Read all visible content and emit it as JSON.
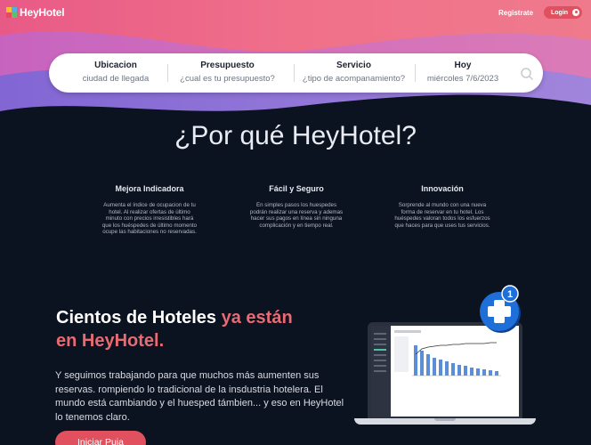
{
  "header": {
    "logo_text": "HeyHotel",
    "register_label": "Registrate",
    "login_label": "Login"
  },
  "search": {
    "location": {
      "title": "Ubicacion",
      "placeholder": "ciudad de llegada"
    },
    "budget": {
      "title": "Presupuesto",
      "placeholder": "¿cual es tu presupuesto?"
    },
    "service": {
      "title": "Servicio",
      "placeholder": "¿tipo de acompanamiento?"
    },
    "date": {
      "title": "Hoy",
      "value": "miércoles 7/6/2023"
    }
  },
  "why": {
    "title": "¿Por qué HeyHotel?",
    "features": [
      {
        "title": "Mejora Indicadora",
        "text": "Aumenta el índice de ocupacion de tu hotel. Al realizar ofertas de último minuto con precios irresistibles hará que los huéspedes de último momento ocupe las habitaciones no reservadas."
      },
      {
        "title": "Fácil y Seguro",
        "text": "En simples pasos los huespedes podrán realizar una reserva y ademas hacer sus pagos en línea sin ninguna complicación y en tiempo real."
      },
      {
        "title": "Innovación",
        "text": "Sorprende al mundo con una nueva forma de reservar en tu hotel. Los huéspedes valoran todos los esfuerzos que haces para que uses tus servicios."
      }
    ]
  },
  "promo": {
    "title_part1": "Cientos de Hoteles",
    "title_part2": "ya están",
    "title_part3": "en HeyHotel.",
    "description": "Y seguimos trabajando para que muchos más aumenten sus reservas. rompiendo lo tradicional de la insdustria hotelera. El mundo está cambiando y el huesped támbien... y eso en HeyHotel lo tenemos claro.",
    "cta_label": "Iniciar Puja",
    "badge_count": "1"
  },
  "colors": {
    "accent": "#e0505e",
    "dark_bg": "#0b1220",
    "hero_pink": "#ef6a86",
    "hero_purple": "#8c6fd1"
  }
}
